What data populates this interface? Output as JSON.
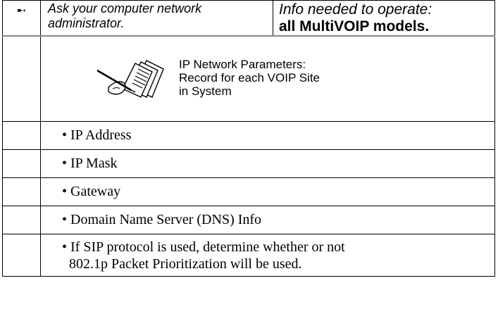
{
  "header": {
    "marker_icon": "arrow-right-icon",
    "marker_glyph": "➸",
    "note": "Ask your computer network administrator.",
    "info_label": "Info needed to operate:",
    "info_models": "all MultiVOIP models."
  },
  "section": {
    "icon": "writing-hand-papers-icon",
    "title_line1": "IP Network Parameters:",
    "title_line2": "Record for each VOIP Site",
    "title_line3": "in System"
  },
  "items": [
    {
      "bullet": "•",
      "text": "IP Address"
    },
    {
      "bullet": "•",
      "text": "IP Mask"
    },
    {
      "bullet": "•",
      "text": "Gateway"
    },
    {
      "bullet": "•",
      "text": "Domain Name Server (DNS) Info"
    },
    {
      "bullet": "•",
      "line1": "If SIP protocol is used, determine whether or not",
      "line2": "802.1p Packet Prioritization will be used."
    }
  ]
}
